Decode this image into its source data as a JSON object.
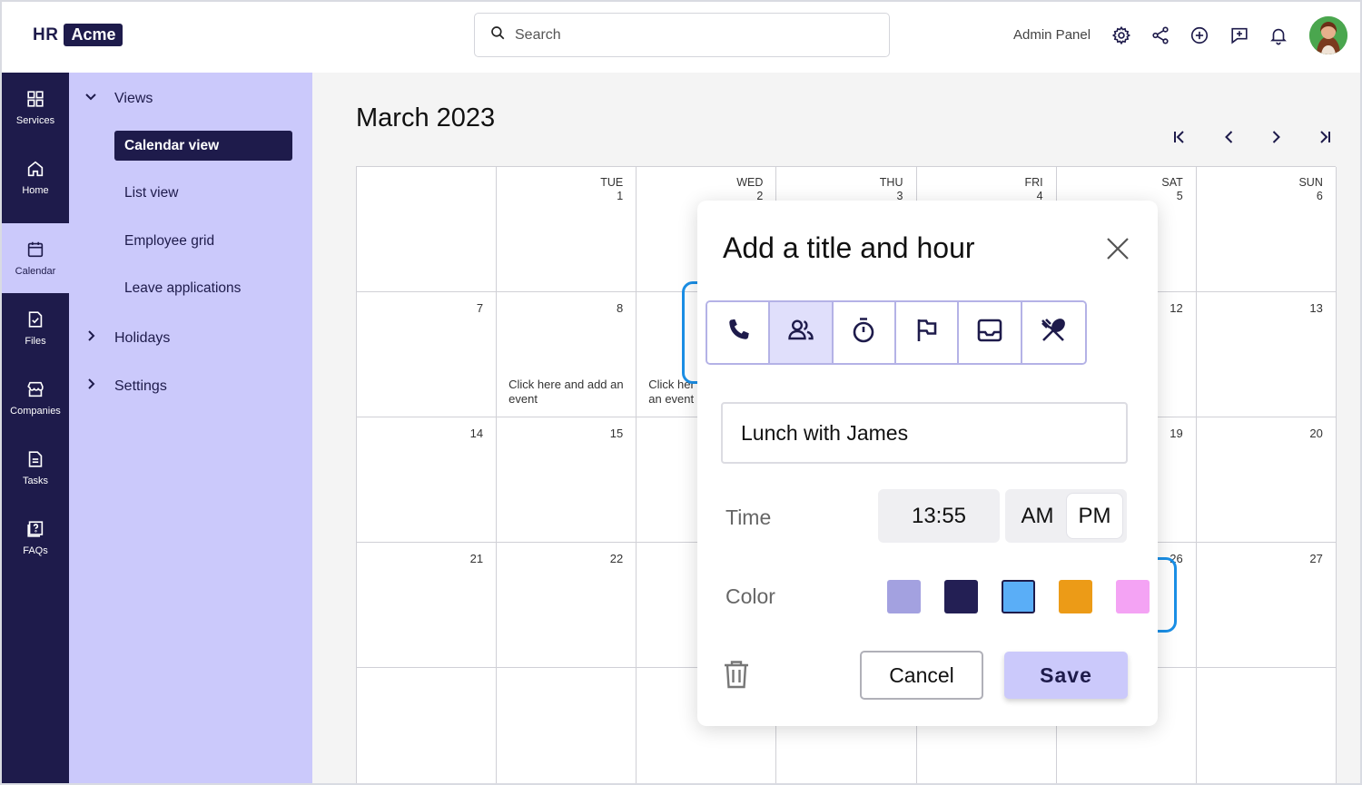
{
  "brand": {
    "hr": "HR",
    "acme": "Acme"
  },
  "search": {
    "placeholder": "Search"
  },
  "header": {
    "admin_label": "Admin Panel"
  },
  "icons": {
    "settings": "gear-icon",
    "share": "share-icon",
    "add": "plus-circle-icon",
    "feedback": "message-plus-icon",
    "notifications": "bell-icon"
  },
  "rail": [
    {
      "label": "Services",
      "icon": "grid-icon"
    },
    {
      "label": "Home",
      "icon": "home-icon"
    },
    {
      "label": "Calendar",
      "icon": "calendar-icon",
      "active": true
    },
    {
      "label": "Files",
      "icon": "file-check-icon"
    },
    {
      "label": "Companies",
      "icon": "store-icon"
    },
    {
      "label": "Tasks",
      "icon": "document-icon"
    },
    {
      "label": "FAQs",
      "icon": "help-icon"
    }
  ],
  "sidenav": {
    "views_label": "Views",
    "items": [
      "Calendar view",
      "List view",
      "Employee grid",
      "Leave applications"
    ],
    "active_item": "Calendar view",
    "holidays_label": "Holidays",
    "settings_label": "Settings"
  },
  "calendar": {
    "month_title": "March 2023",
    "header_cells": [
      {
        "dow": "",
        "day": ""
      },
      {
        "dow": "TUE",
        "day": "1"
      },
      {
        "dow": "WED",
        "day": "2"
      },
      {
        "dow": "THU",
        "day": "3"
      },
      {
        "dow": "FRI",
        "day": "4"
      },
      {
        "dow": "SAT",
        "day": "5"
      },
      {
        "dow": "SUN",
        "day": "6"
      }
    ],
    "weeks": [
      [
        "7",
        "8",
        "",
        "",
        "",
        "12",
        "13"
      ],
      [
        "14",
        "15",
        "",
        "",
        "",
        "19",
        "20"
      ],
      [
        "21",
        "22",
        "",
        "",
        "",
        "26",
        "27"
      ],
      [
        "",
        "",
        "",
        "",
        "",
        "",
        ""
      ]
    ],
    "hint_full": "Click here and add an event",
    "hint_partial": "Click her an event"
  },
  "dialog": {
    "title": "Add a title and hour",
    "event_types": [
      "phone-icon",
      "people-icon",
      "stopwatch-icon",
      "flag-icon",
      "inbox-icon",
      "utensils-icon"
    ],
    "selected_type": "people-icon",
    "title_value": "Lunch with James",
    "time_label": "Time",
    "time_value": "13:55",
    "am_label": "AM",
    "pm_label": "PM",
    "selected_meridiem": "PM",
    "color_label": "Color",
    "colors": [
      "#a3a1e0",
      "#231f54",
      "#5aaef7",
      "#ec9b17",
      "#f4a3f4"
    ],
    "selected_color": "#5aaef7",
    "cancel_label": "Cancel",
    "save_label": "Save"
  }
}
